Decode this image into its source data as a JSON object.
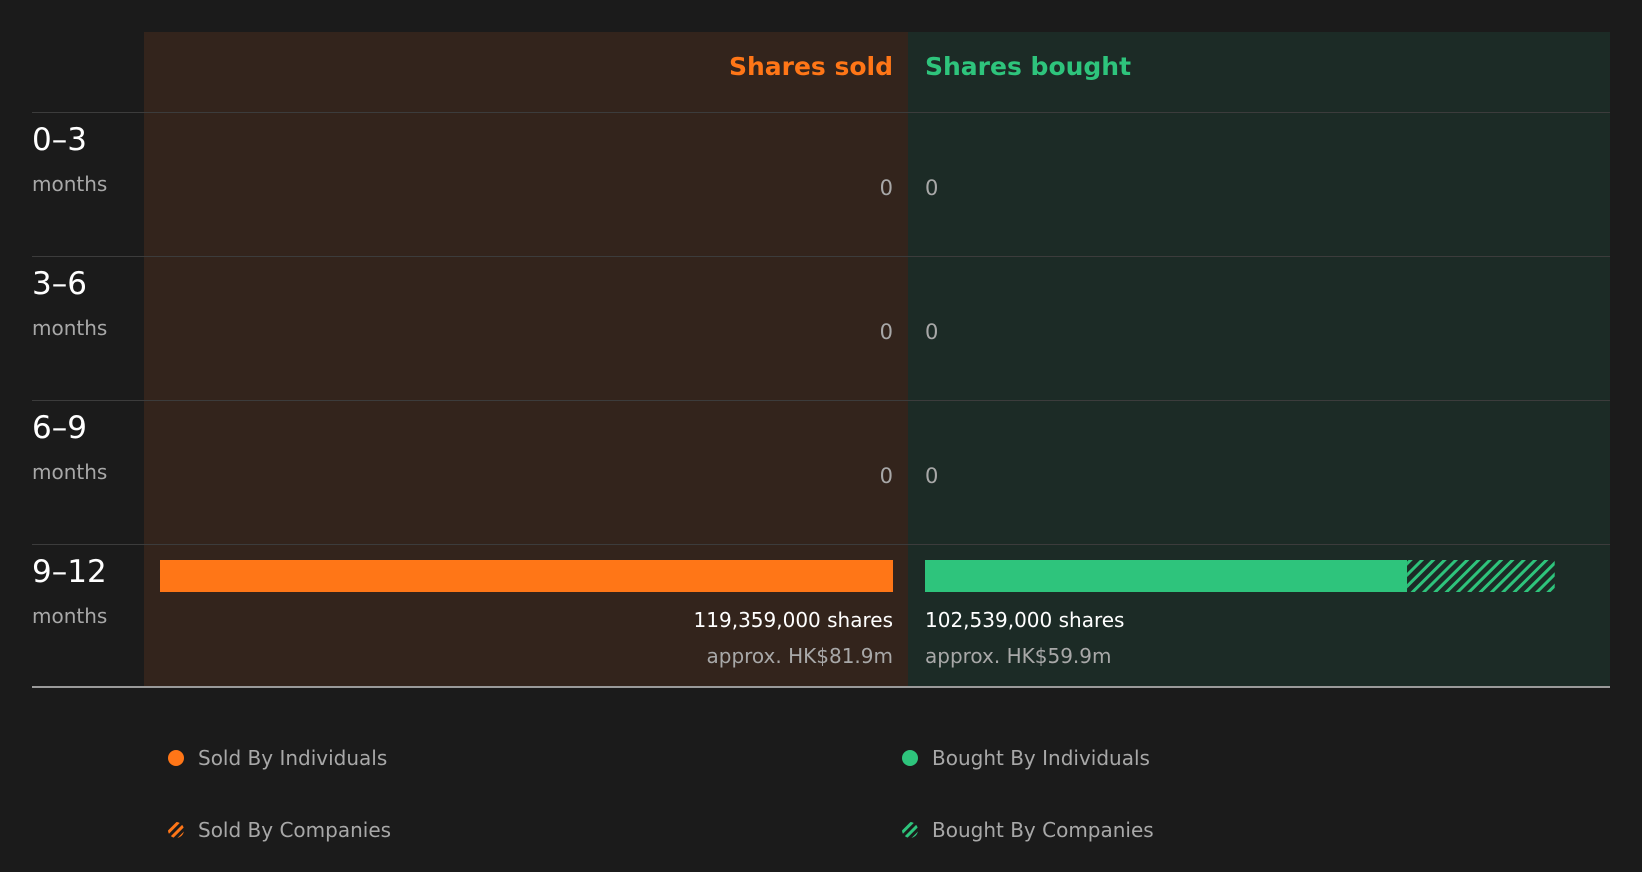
{
  "colors": {
    "sold": "#ff7617",
    "bought": "#2ec47c"
  },
  "chart_data": {
    "type": "bar",
    "title": "",
    "orientation": "horizontal-diverging",
    "column_headers": {
      "sold": "Shares sold",
      "bought": "Shares bought"
    },
    "categories": [
      {
        "range": "0–3",
        "unit": "months"
      },
      {
        "range": "3–6",
        "unit": "months"
      },
      {
        "range": "6–9",
        "unit": "months"
      },
      {
        "range": "9–12",
        "unit": "months"
      }
    ],
    "series": [
      {
        "name": "Shares sold",
        "values": [
          0,
          0,
          0,
          119359000
        ],
        "individuals": [
          0,
          0,
          0,
          119359000
        ],
        "companies": [
          0,
          0,
          0,
          0
        ],
        "labels": [
          "0",
          "0",
          "0",
          "119,359,000 shares"
        ],
        "sublabels": [
          "",
          "",
          "",
          "approx. HK$81.9m"
        ]
      },
      {
        "name": "Shares bought",
        "values": [
          0,
          0,
          0,
          102539000
        ],
        "individuals": [
          0,
          0,
          0,
          78500000
        ],
        "companies": [
          0,
          0,
          0,
          24039000
        ],
        "labels": [
          "0",
          "0",
          "0",
          "102,539,000 shares"
        ],
        "sublabels": [
          "",
          "",
          "",
          "approx. HK$59.9m"
        ]
      }
    ],
    "xlim": [
      0,
      119359000
    ],
    "legend": [
      {
        "label": "Sold By Individuals",
        "side": "sold",
        "pattern": "solid"
      },
      {
        "label": "Sold By Companies",
        "side": "sold",
        "pattern": "hatched"
      },
      {
        "label": "Bought By Individuals",
        "side": "bought",
        "pattern": "solid"
      },
      {
        "label": "Bought By Companies",
        "side": "bought",
        "pattern": "hatched"
      }
    ],
    "legend_position": "bottom",
    "grid": false
  }
}
